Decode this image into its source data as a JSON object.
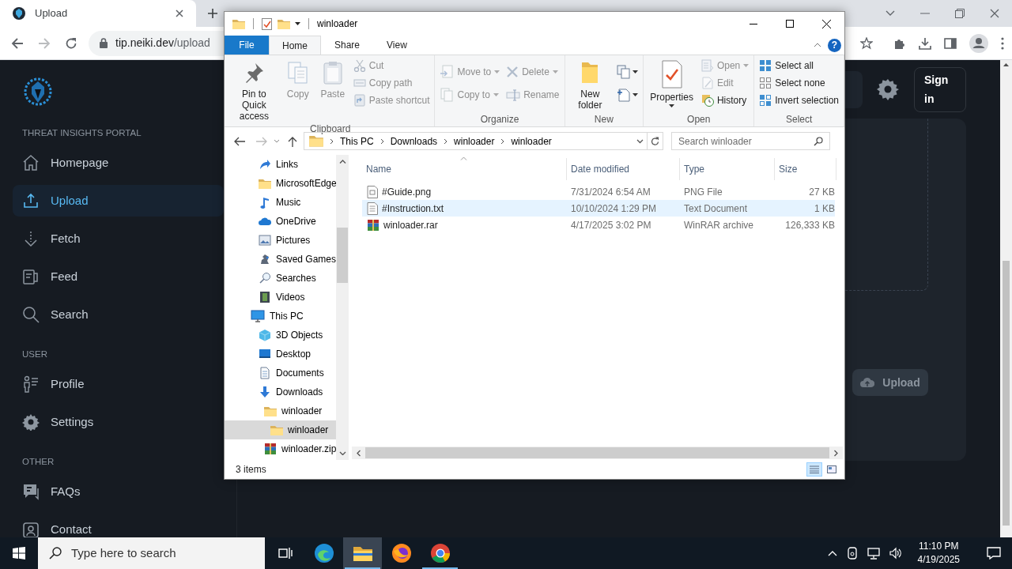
{
  "browser": {
    "tab": {
      "title": "Upload"
    },
    "address": {
      "host": "tip.neiki.dev",
      "path": "/upload"
    }
  },
  "sidebar": {
    "sections": [
      {
        "heading": "THREAT INSIGHTS PORTAL",
        "items": [
          {
            "label": "Homepage",
            "selected": false
          },
          {
            "label": "Upload",
            "selected": true
          },
          {
            "label": "Fetch",
            "selected": false
          },
          {
            "label": "Feed",
            "selected": false
          },
          {
            "label": "Search",
            "selected": false
          }
        ]
      },
      {
        "heading": "USER",
        "items": [
          {
            "label": "Profile",
            "selected": false
          },
          {
            "label": "Settings",
            "selected": false
          }
        ]
      },
      {
        "heading": "OTHER",
        "items": [
          {
            "label": "FAQs",
            "selected": false
          },
          {
            "label": "Contact",
            "selected": false
          }
        ]
      }
    ]
  },
  "header": {
    "sign_in": "Sign in"
  },
  "upload_card": {
    "upload_button": "Upload"
  },
  "explorer": {
    "title": "winloader",
    "help_button": "?",
    "ribbon_tabs": [
      {
        "label": "File",
        "kind": "menu",
        "selected": false
      },
      {
        "label": "Home",
        "kind": "tab",
        "selected": true
      },
      {
        "label": "Share",
        "kind": "tab",
        "selected": false
      },
      {
        "label": "View",
        "kind": "tab",
        "selected": false
      }
    ],
    "ribbon_groups": [
      {
        "label": "Clipboard",
        "commands": [
          {
            "label": "Pin to Quick access",
            "kind": "large",
            "disabled": false,
            "dropdown": false
          },
          {
            "label": "Copy",
            "kind": "large",
            "disabled": true,
            "dropdown": false
          },
          {
            "label": "Paste",
            "kind": "large",
            "disabled": true,
            "dropdown": false
          },
          {
            "label": "Cut",
            "kind": "small",
            "disabled": true,
            "dropdown": false
          },
          {
            "label": "Copy path",
            "kind": "small",
            "disabled": true,
            "dropdown": false
          },
          {
            "label": "Paste shortcut",
            "kind": "small",
            "disabled": true,
            "dropdown": false
          }
        ]
      },
      {
        "label": "Organize",
        "commands": [
          {
            "label": "Move to",
            "kind": "medium",
            "disabled": true,
            "dropdown": true
          },
          {
            "label": "Copy to",
            "kind": "medium",
            "disabled": true,
            "dropdown": true
          },
          {
            "label": "Delete",
            "kind": "medium",
            "disabled": true,
            "dropdown": true
          },
          {
            "label": "Rename",
            "kind": "medium",
            "disabled": true,
            "dropdown": false
          }
        ]
      },
      {
        "label": "New",
        "commands": [
          {
            "label": "New folder",
            "kind": "large",
            "disabled": false,
            "dropdown": false
          },
          {
            "kind": "icon",
            "disabled": false,
            "dropdown": true
          },
          {
            "kind": "icon",
            "disabled": false,
            "dropdown": true
          }
        ]
      },
      {
        "label": "Open",
        "commands": [
          {
            "label": "Properties",
            "kind": "large",
            "disabled": false,
            "dropdown": true
          },
          {
            "label": "Open",
            "kind": "small",
            "disabled": true,
            "dropdown": true
          },
          {
            "label": "Edit",
            "kind": "small",
            "disabled": true,
            "dropdown": false
          },
          {
            "label": "History",
            "kind": "small",
            "disabled": false,
            "dropdown": false
          }
        ]
      },
      {
        "label": "Select",
        "commands": [
          {
            "label": "Select all",
            "kind": "small",
            "disabled": false,
            "dropdown": false
          },
          {
            "label": "Select none",
            "kind": "small",
            "disabled": false,
            "dropdown": false
          },
          {
            "label": "Invert selection",
            "kind": "small",
            "disabled": false,
            "dropdown": false
          }
        ]
      }
    ],
    "breadcrumb": [
      "This PC",
      "Downloads",
      "winloader",
      "winloader"
    ],
    "search": {
      "placeholder": "Search winloader"
    },
    "nav_tree": [
      {
        "label": "Links",
        "selected": false
      },
      {
        "label": "MicrosoftEdge",
        "selected": false
      },
      {
        "label": "Music",
        "selected": false
      },
      {
        "label": "OneDrive",
        "selected": false
      },
      {
        "label": "Pictures",
        "selected": false
      },
      {
        "label": "Saved Games",
        "selected": false
      },
      {
        "label": "Searches",
        "selected": false
      },
      {
        "label": "Videos",
        "selected": false
      },
      {
        "label": "This PC",
        "selected": false,
        "children": [
          {
            "label": "3D Objects",
            "selected": false
          },
          {
            "label": "Desktop",
            "selected": false
          },
          {
            "label": "Documents",
            "selected": false
          },
          {
            "label": "Downloads",
            "selected": false,
            "children": [
              {
                "label": "winloader",
                "selected": false,
                "children": [
                  {
                    "label": "winloader",
                    "selected": true
                  }
                ]
              },
              {
                "label": "winloader.zip",
                "selected": false
              }
            ]
          }
        ]
      }
    ],
    "columns": [
      "Name",
      "Date modified",
      "Type",
      "Size"
    ],
    "files": [
      {
        "name": "#Guide.png",
        "date_modified": "7/31/2024 6:54 AM",
        "type": "PNG File",
        "size": "27 KB",
        "selected": false
      },
      {
        "name": "#Instruction.txt",
        "date_modified": "10/10/2024 1:29 PM",
        "type": "Text Document",
        "size": "1 KB",
        "selected": true
      },
      {
        "name": "winloader.rar",
        "date_modified": "4/17/2025 3:02 PM",
        "type": "WinRAR archive",
        "size": "126,333 KB",
        "selected": false
      }
    ],
    "status_bar": "3 items"
  },
  "taskbar": {
    "search": {
      "placeholder": "Type here to search"
    },
    "apps": [
      {
        "running": false,
        "active": false
      },
      {
        "running": true,
        "active": true
      },
      {
        "running": false,
        "active": false
      },
      {
        "running": true,
        "active": false
      }
    ],
    "time": "11:10 PM",
    "date": "4/19/2025"
  }
}
